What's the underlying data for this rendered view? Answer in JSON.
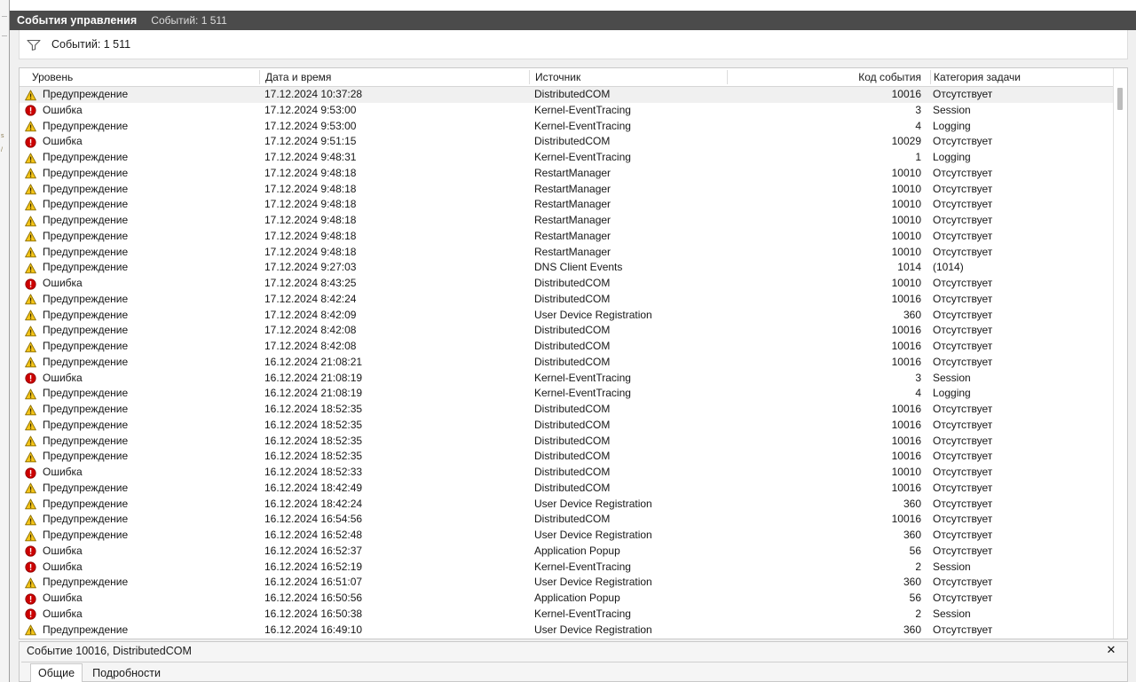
{
  "window": {
    "caption_title": "События управления",
    "caption_count": "Событий: 1 511"
  },
  "filterbar": {
    "icon": "funnel-icon",
    "label": "Событий: 1 511"
  },
  "table": {
    "columns": [
      {
        "key": "level",
        "label": "Уровень"
      },
      {
        "key": "datetime",
        "label": "Дата и время"
      },
      {
        "key": "source",
        "label": "Источник"
      },
      {
        "key": "code",
        "label": "Код события"
      },
      {
        "key": "category",
        "label": "Категория задачи"
      }
    ],
    "rows": [
      {
        "level": "Предупреждение",
        "icon": "warning-icon",
        "datetime": "17.12.2024 10:37:28",
        "source": "DistributedCOM",
        "code": "10016",
        "category": "Отсутствует",
        "selected": true
      },
      {
        "level": "Ошибка",
        "icon": "error-icon",
        "datetime": "17.12.2024 9:53:00",
        "source": "Kernel-EventTracing",
        "code": "3",
        "category": "Session"
      },
      {
        "level": "Предупреждение",
        "icon": "warning-icon",
        "datetime": "17.12.2024 9:53:00",
        "source": "Kernel-EventTracing",
        "code": "4",
        "category": "Logging"
      },
      {
        "level": "Ошибка",
        "icon": "error-icon",
        "datetime": "17.12.2024 9:51:15",
        "source": "DistributedCOM",
        "code": "10029",
        "category": "Отсутствует"
      },
      {
        "level": "Предупреждение",
        "icon": "warning-icon",
        "datetime": "17.12.2024 9:48:31",
        "source": "Kernel-EventTracing",
        "code": "1",
        "category": "Logging"
      },
      {
        "level": "Предупреждение",
        "icon": "warning-icon",
        "datetime": "17.12.2024 9:48:18",
        "source": "RestartManager",
        "code": "10010",
        "category": "Отсутствует"
      },
      {
        "level": "Предупреждение",
        "icon": "warning-icon",
        "datetime": "17.12.2024 9:48:18",
        "source": "RestartManager",
        "code": "10010",
        "category": "Отсутствует"
      },
      {
        "level": "Предупреждение",
        "icon": "warning-icon",
        "datetime": "17.12.2024 9:48:18",
        "source": "RestartManager",
        "code": "10010",
        "category": "Отсутствует"
      },
      {
        "level": "Предупреждение",
        "icon": "warning-icon",
        "datetime": "17.12.2024 9:48:18",
        "source": "RestartManager",
        "code": "10010",
        "category": "Отсутствует"
      },
      {
        "level": "Предупреждение",
        "icon": "warning-icon",
        "datetime": "17.12.2024 9:48:18",
        "source": "RestartManager",
        "code": "10010",
        "category": "Отсутствует"
      },
      {
        "level": "Предупреждение",
        "icon": "warning-icon",
        "datetime": "17.12.2024 9:48:18",
        "source": "RestartManager",
        "code": "10010",
        "category": "Отсутствует"
      },
      {
        "level": "Предупреждение",
        "icon": "warning-icon",
        "datetime": "17.12.2024 9:27:03",
        "source": "DNS Client Events",
        "code": "1014",
        "category": "(1014)"
      },
      {
        "level": "Ошибка",
        "icon": "error-icon",
        "datetime": "17.12.2024 8:43:25",
        "source": "DistributedCOM",
        "code": "10010",
        "category": "Отсутствует"
      },
      {
        "level": "Предупреждение",
        "icon": "warning-icon",
        "datetime": "17.12.2024 8:42:24",
        "source": "DistributedCOM",
        "code": "10016",
        "category": "Отсутствует"
      },
      {
        "level": "Предупреждение",
        "icon": "warning-icon",
        "datetime": "17.12.2024 8:42:09",
        "source": "User Device Registration",
        "code": "360",
        "category": "Отсутствует"
      },
      {
        "level": "Предупреждение",
        "icon": "warning-icon",
        "datetime": "17.12.2024 8:42:08",
        "source": "DistributedCOM",
        "code": "10016",
        "category": "Отсутствует"
      },
      {
        "level": "Предупреждение",
        "icon": "warning-icon",
        "datetime": "17.12.2024 8:42:08",
        "source": "DistributedCOM",
        "code": "10016",
        "category": "Отсутствует"
      },
      {
        "level": "Предупреждение",
        "icon": "warning-icon",
        "datetime": "16.12.2024 21:08:21",
        "source": "DistributedCOM",
        "code": "10016",
        "category": "Отсутствует"
      },
      {
        "level": "Ошибка",
        "icon": "error-icon",
        "datetime": "16.12.2024 21:08:19",
        "source": "Kernel-EventTracing",
        "code": "3",
        "category": "Session"
      },
      {
        "level": "Предупреждение",
        "icon": "warning-icon",
        "datetime": "16.12.2024 21:08:19",
        "source": "Kernel-EventTracing",
        "code": "4",
        "category": "Logging"
      },
      {
        "level": "Предупреждение",
        "icon": "warning-icon",
        "datetime": "16.12.2024 18:52:35",
        "source": "DistributedCOM",
        "code": "10016",
        "category": "Отсутствует"
      },
      {
        "level": "Предупреждение",
        "icon": "warning-icon",
        "datetime": "16.12.2024 18:52:35",
        "source": "DistributedCOM",
        "code": "10016",
        "category": "Отсутствует"
      },
      {
        "level": "Предупреждение",
        "icon": "warning-icon",
        "datetime": "16.12.2024 18:52:35",
        "source": "DistributedCOM",
        "code": "10016",
        "category": "Отсутствует"
      },
      {
        "level": "Предупреждение",
        "icon": "warning-icon",
        "datetime": "16.12.2024 18:52:35",
        "source": "DistributedCOM",
        "code": "10016",
        "category": "Отсутствует"
      },
      {
        "level": "Ошибка",
        "icon": "error-icon",
        "datetime": "16.12.2024 18:52:33",
        "source": "DistributedCOM",
        "code": "10010",
        "category": "Отсутствует"
      },
      {
        "level": "Предупреждение",
        "icon": "warning-icon",
        "datetime": "16.12.2024 18:42:49",
        "source": "DistributedCOM",
        "code": "10016",
        "category": "Отсутствует"
      },
      {
        "level": "Предупреждение",
        "icon": "warning-icon",
        "datetime": "16.12.2024 18:42:24",
        "source": "User Device Registration",
        "code": "360",
        "category": "Отсутствует"
      },
      {
        "level": "Предупреждение",
        "icon": "warning-icon",
        "datetime": "16.12.2024 16:54:56",
        "source": "DistributedCOM",
        "code": "10016",
        "category": "Отсутствует"
      },
      {
        "level": "Предупреждение",
        "icon": "warning-icon",
        "datetime": "16.12.2024 16:52:48",
        "source": "User Device Registration",
        "code": "360",
        "category": "Отсутствует"
      },
      {
        "level": "Ошибка",
        "icon": "error-icon",
        "datetime": "16.12.2024 16:52:37",
        "source": "Application Popup",
        "code": "56",
        "category": "Отсутствует"
      },
      {
        "level": "Ошибка",
        "icon": "error-icon",
        "datetime": "16.12.2024 16:52:19",
        "source": "Kernel-EventTracing",
        "code": "2",
        "category": "Session"
      },
      {
        "level": "Предупреждение",
        "icon": "warning-icon",
        "datetime": "16.12.2024 16:51:07",
        "source": "User Device Registration",
        "code": "360",
        "category": "Отсутствует"
      },
      {
        "level": "Ошибка",
        "icon": "error-icon",
        "datetime": "16.12.2024 16:50:56",
        "source": "Application Popup",
        "code": "56",
        "category": "Отсутствует"
      },
      {
        "level": "Ошибка",
        "icon": "error-icon",
        "datetime": "16.12.2024 16:50:38",
        "source": "Kernel-EventTracing",
        "code": "2",
        "category": "Session"
      },
      {
        "level": "Предупреждение",
        "icon": "warning-icon",
        "datetime": "16.12.2024 16:49:10",
        "source": "User Device Registration",
        "code": "360",
        "category": "Отсутствует"
      }
    ]
  },
  "details": {
    "title": "Событие 10016, DistributedCOM",
    "close_label": "✕",
    "tabs": [
      {
        "label": "Общие",
        "active": true
      },
      {
        "label": "Подробности",
        "active": false
      }
    ]
  },
  "colors": {
    "caption_bg": "#4b4b4b",
    "warning": "#f5c518",
    "error": "#cc0000",
    "selection": "#f0f0f0"
  }
}
